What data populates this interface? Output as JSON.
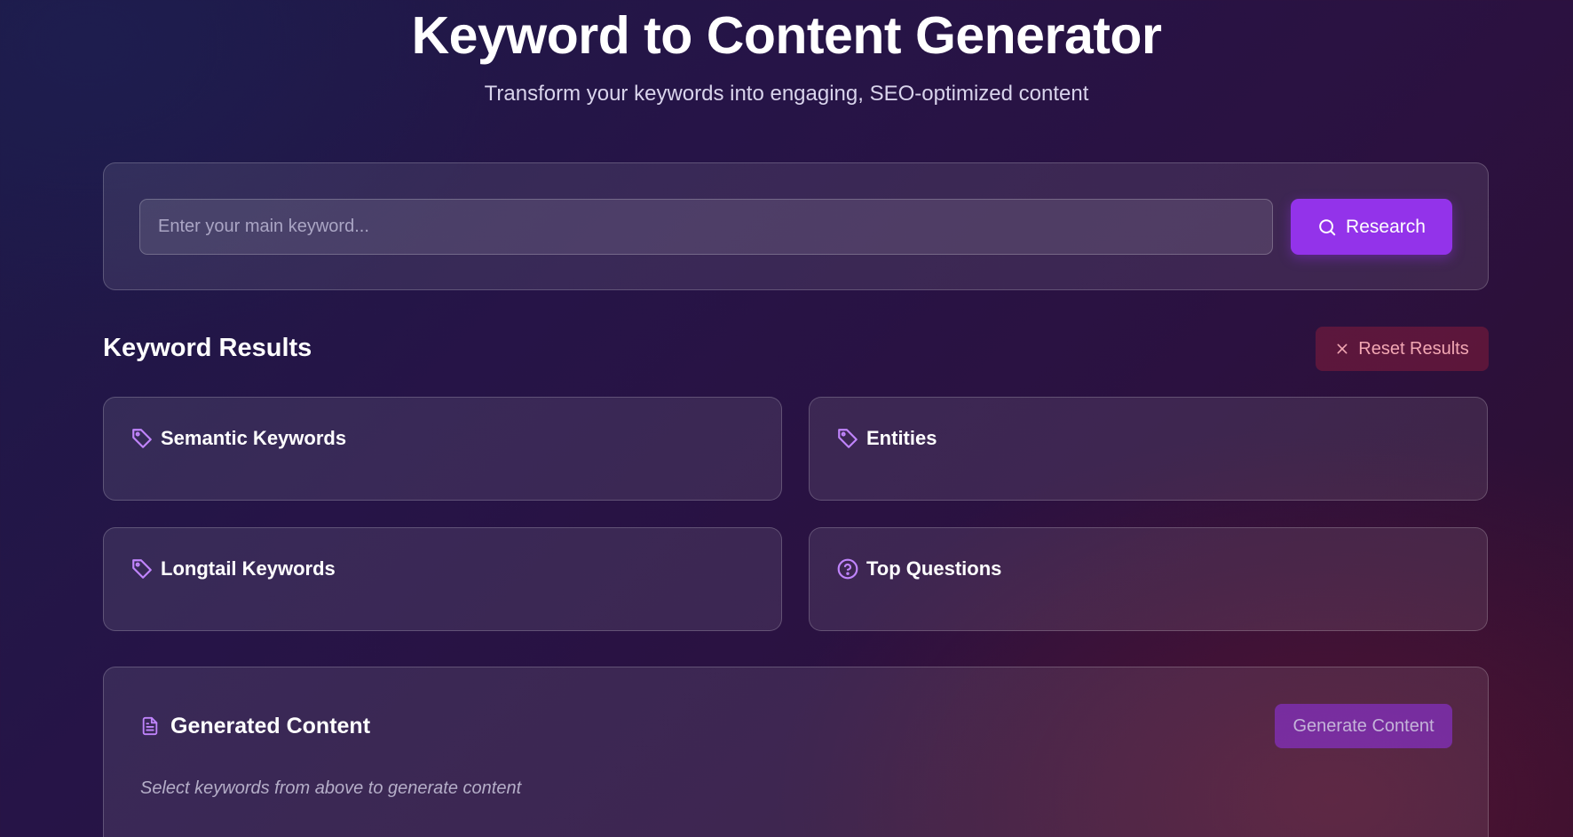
{
  "header": {
    "title": "Keyword to Content Generator",
    "subtitle": "Transform your keywords into engaging, SEO-optimized content"
  },
  "search": {
    "placeholder": "Enter your main keyword...",
    "value": "",
    "button_label": "Research",
    "button_icon": "search-icon"
  },
  "results": {
    "title": "Keyword Results",
    "reset_label": "Reset Results",
    "reset_icon": "close-icon",
    "cards": [
      {
        "title": "Semantic Keywords",
        "icon": "tag-icon"
      },
      {
        "title": "Entities",
        "icon": "tag-icon"
      },
      {
        "title": "Longtail Keywords",
        "icon": "tag-icon"
      },
      {
        "title": "Top Questions",
        "icon": "question-circle-icon"
      }
    ]
  },
  "content": {
    "title": "Generated Content",
    "icon": "document-icon",
    "generate_label": "Generate Content",
    "hint": "Select keywords from above to generate content"
  },
  "colors": {
    "accent": "#9333ea",
    "icon": "#c084fc",
    "reset_text": "#f2a7b3"
  }
}
